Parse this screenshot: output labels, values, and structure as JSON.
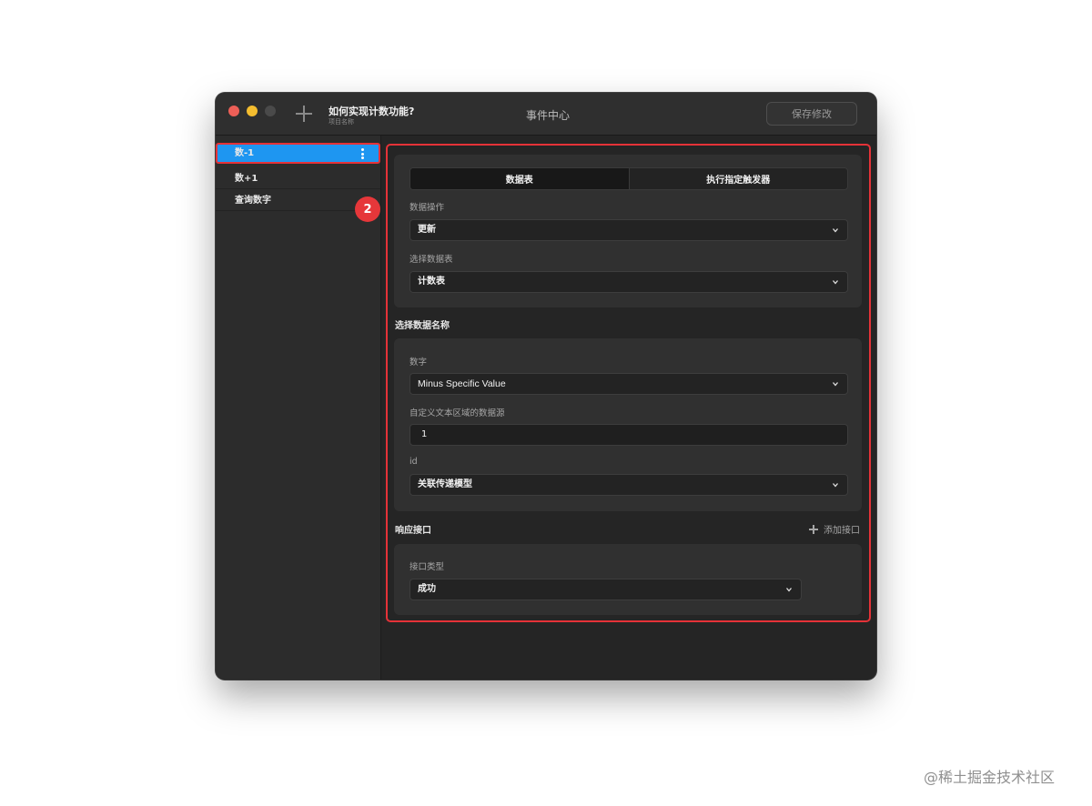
{
  "titlebar": {
    "project_title": "如何实现计数功能?",
    "project_subtitle": "项目名称",
    "center_title": "事件中心",
    "save_label": "保存修改"
  },
  "sidebar": {
    "items": [
      {
        "label": "数-1",
        "active": true
      },
      {
        "label": "数+1",
        "active": false
      },
      {
        "label": "查询数字",
        "active": false
      }
    ]
  },
  "badge": "2",
  "tabs": [
    {
      "label": "数据表",
      "active": true
    },
    {
      "label": "执行指定触发器",
      "active": false
    }
  ],
  "form1": {
    "data_op_label": "数据操作",
    "data_op_value": "更新",
    "table_label": "选择数据表",
    "table_value": "计数表"
  },
  "select_name_section": "选择数据名称",
  "form2": {
    "number_label": "数字",
    "number_value": "Minus Specific Value",
    "custom_label": "自定义文本区域的数据源",
    "custom_value": "1",
    "id_label": "id",
    "id_value": "关联传递模型"
  },
  "response": {
    "section_label": "响应接口",
    "add_label": "添加接口",
    "type_label": "接口类型",
    "type_value": "成功"
  },
  "watermark": "@稀土掘金技术社区",
  "colors": {
    "accent": "#1e96f1",
    "highlight": "#e53238",
    "window_bg": "#252525"
  }
}
